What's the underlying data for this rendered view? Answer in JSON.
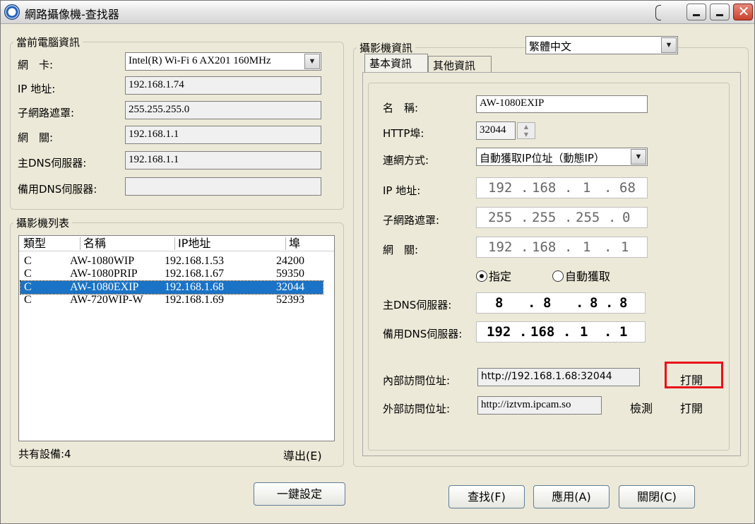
{
  "window": {
    "title": "網路攝像機-查找器",
    "close_glyph": "✕"
  },
  "local": {
    "legend": "當前電腦資訊",
    "nic_label": "網　卡:",
    "nic_value": "Intel(R) Wi-Fi 6 AX201 160MHz",
    "ip_label": "IP  地址:",
    "ip_value": "192.168.1.74",
    "mask_label": "子網路遮罩:",
    "mask_value": "255.255.255.0",
    "gateway_label": "網　關:",
    "gateway_value": "192.168.1.1",
    "dns1_label": "主DNS伺服器:",
    "dns1_value": "192.168.1.1",
    "dns2_label": "備用DNS伺服器:",
    "dns2_value": ""
  },
  "camlist": {
    "legend": "攝影機列表",
    "columns": [
      "類型",
      "名稱",
      "IP地址",
      "埠"
    ],
    "rows": [
      {
        "type": "C",
        "name": "AW-1080WIP",
        "ip": "192.168.1.53",
        "port": "24200"
      },
      {
        "type": "C",
        "name": "AW-1080PRIP",
        "ip": "192.168.1.67",
        "port": "59350"
      },
      {
        "type": "C",
        "name": "AW-1080EXIP",
        "ip": "192.168.1.68",
        "port": "32044"
      },
      {
        "type": "C",
        "name": "AW-720WIP-W",
        "ip": "192.168.1.69",
        "port": "52393"
      }
    ],
    "selected_index": 2,
    "total_label": "共有設備:4",
    "export_label": "導出(E)"
  },
  "camera": {
    "legend": "攝影機資訊",
    "language_value": "繁體中文",
    "tabs": [
      "基本資訊",
      "其他資訊"
    ],
    "name_label": "名　稱:",
    "name_value": "AW-1080EXIP",
    "http_label": "HTTP埠:",
    "http_value": "32044",
    "mode_label": "連網方式:",
    "mode_value": "自動獲取IP位址（動態IP）",
    "ip_label": "IP  地址:",
    "ip_octets": [
      "192",
      "168",
      "1",
      "68"
    ],
    "mask_label": "子網路遮罩:",
    "mask_octets": [
      "255",
      "255",
      "255",
      "0"
    ],
    "gateway_label": "網　關:",
    "gateway_octets": [
      "192",
      "168",
      "1",
      "1"
    ],
    "radio_fixed": "指定",
    "radio_auto": "自動獲取",
    "dns1_label": "主DNS伺服器:",
    "dns1_octets": [
      "8",
      "8",
      "8",
      "8"
    ],
    "dns2_label": "備用DNS伺服器:",
    "dns2_octets": [
      "192",
      "168",
      "1",
      "1"
    ],
    "internal_label": "內部訪問位址:",
    "internal_value": "http://192.168.1.68:32044",
    "internal_open": "打開",
    "external_label": "外部訪問位址:",
    "external_value": "http://iztvm.ipcam.so",
    "external_check": "檢測",
    "external_open": "打開"
  },
  "buttons": {
    "one_key": "一鍵設定",
    "search": "查找(F)",
    "apply": "應用(A)",
    "close": "關閉(C)"
  },
  "colors": {
    "selection": "#1a73c6",
    "highlight": "#e8101a"
  }
}
